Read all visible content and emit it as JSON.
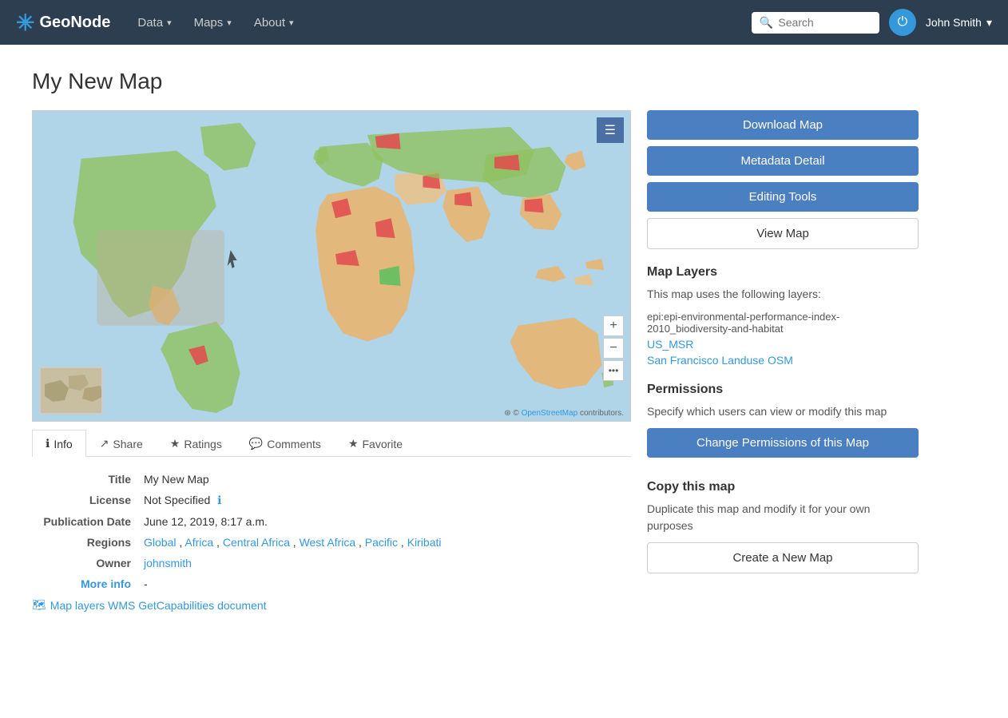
{
  "brand": {
    "name": "GeoNode",
    "logo_icon": "✳"
  },
  "navbar": {
    "items": [
      {
        "label": "Data",
        "has_dropdown": true
      },
      {
        "label": "Maps",
        "has_dropdown": true
      },
      {
        "label": "About",
        "has_dropdown": true
      }
    ],
    "search_placeholder": "Search",
    "user": "John Smith"
  },
  "page": {
    "title": "My New Map"
  },
  "map": {
    "attribution_prefix": "© ",
    "attribution_link_text": "OpenStreetMap",
    "attribution_suffix": " contributors."
  },
  "tabs": [
    {
      "label": "Info",
      "icon": "ℹ",
      "active": true
    },
    {
      "label": "Share",
      "icon": "↗"
    },
    {
      "label": "Ratings",
      "icon": "★"
    },
    {
      "label": "Comments",
      "icon": "💬"
    },
    {
      "label": "Favorite",
      "icon": "★"
    }
  ],
  "info": {
    "fields": [
      {
        "label": "Title",
        "value": "My New Map",
        "type": "text"
      },
      {
        "label": "License",
        "value": "Not Specified",
        "type": "text_with_info"
      },
      {
        "label": "Publication Date",
        "value": "June 12, 2019, 8:17 a.m.",
        "type": "text"
      },
      {
        "label": "Regions",
        "links": [
          "Global",
          "Africa",
          "Central Africa",
          "West Africa",
          "Pacific",
          "Kiribati"
        ],
        "type": "links"
      },
      {
        "label": "Owner",
        "value": "johnsmith",
        "type": "link"
      }
    ],
    "more_info_label": "More info",
    "more_info_value": "-",
    "wms_label": "Map layers WMS GetCapabilities document"
  },
  "sidebar": {
    "download_btn": "Download Map",
    "metadata_btn": "Metadata Detail",
    "editing_btn": "Editing Tools",
    "view_btn": "View Map",
    "map_layers": {
      "title": "Map Layers",
      "description": "This map uses the following layers:",
      "layer_text": "epi:epi-environmental-performance-index-2010_biodiversity-and-habitat",
      "links": [
        "US_MSR",
        "San Francisco Landuse OSM"
      ]
    },
    "permissions": {
      "title": "Permissions",
      "description": "Specify which users can view or modify this map",
      "btn": "Change Permissions of this Map"
    },
    "copy": {
      "title": "Copy this map",
      "description": "Duplicate this map and modify it for your own purposes",
      "btn": "Create a New Map"
    }
  }
}
